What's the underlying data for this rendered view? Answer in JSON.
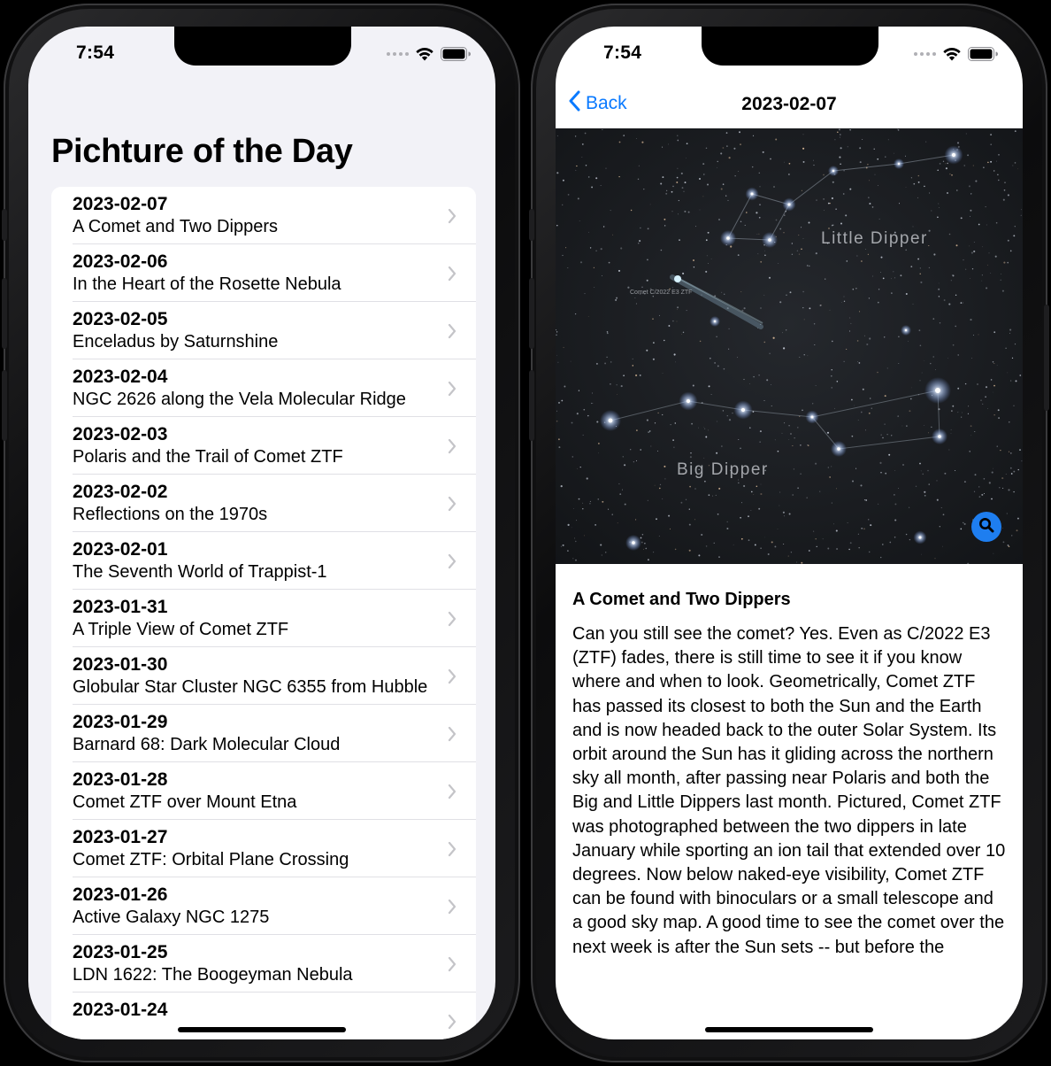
{
  "status": {
    "time": "7:54"
  },
  "list_screen": {
    "title": "Pichture of the Day",
    "items": [
      {
        "date": "2023-02-07",
        "title": "A Comet and Two Dippers"
      },
      {
        "date": "2023-02-06",
        "title": "In the Heart of the Rosette Nebula"
      },
      {
        "date": "2023-02-05",
        "title": "Enceladus by Saturnshine"
      },
      {
        "date": "2023-02-04",
        "title": "NGC 2626 along the Vela Molecular Ridge"
      },
      {
        "date": "2023-02-03",
        "title": "Polaris and the Trail of Comet ZTF"
      },
      {
        "date": "2023-02-02",
        "title": "Reflections on the 1970s"
      },
      {
        "date": "2023-02-01",
        "title": "The Seventh World of Trappist-1"
      },
      {
        "date": "2023-01-31",
        "title": "A Triple View of Comet ZTF"
      },
      {
        "date": "2023-01-30",
        "title": "Globular Star Cluster NGC 6355 from Hubble"
      },
      {
        "date": "2023-01-29",
        "title": "Barnard 68: Dark Molecular Cloud"
      },
      {
        "date": "2023-01-28",
        "title": "Comet ZTF over Mount Etna"
      },
      {
        "date": "2023-01-27",
        "title": "Comet ZTF: Orbital Plane Crossing"
      },
      {
        "date": "2023-01-26",
        "title": "Active Galaxy NGC 1275"
      },
      {
        "date": "2023-01-25",
        "title": "LDN 1622: The Boogeyman Nebula"
      },
      {
        "date": "2023-01-24",
        "title": ""
      }
    ]
  },
  "detail_screen": {
    "back_label": "Back",
    "nav_title": "2023-02-07",
    "image_labels": {
      "little_dipper": "Little Dipper",
      "big_dipper": "Big Dipper",
      "comet": "Comet C/2022 E3 ZTF"
    },
    "article_title": "A Comet and Two Dippers",
    "article_body": "Can you still see the comet?  Yes. Even as C/2022 E3 (ZTF) fades, there is still time to see it if you know where and when to look. Geometrically, Comet ZTF has passed its closest to both the Sun and the Earth and is now headed back to the outer Solar System. Its orbit around the Sun has it gliding across the northern sky all month, after passing near Polaris and both the Big and Little Dippers last month. Pictured, Comet ZTF was photographed between the two dippers in late January while sporting an ion tail that extended over 10 degrees. Now below naked-eye visibility, Comet ZTF can be found with binoculars or a small telescope and a good sky map.  A good time to see the comet over the next week is after the Sun sets -- but before the"
  },
  "colors": {
    "accent": "#0a7aff",
    "list_background": "#f2f2f7",
    "zoom_button": "#1e7ef0"
  }
}
